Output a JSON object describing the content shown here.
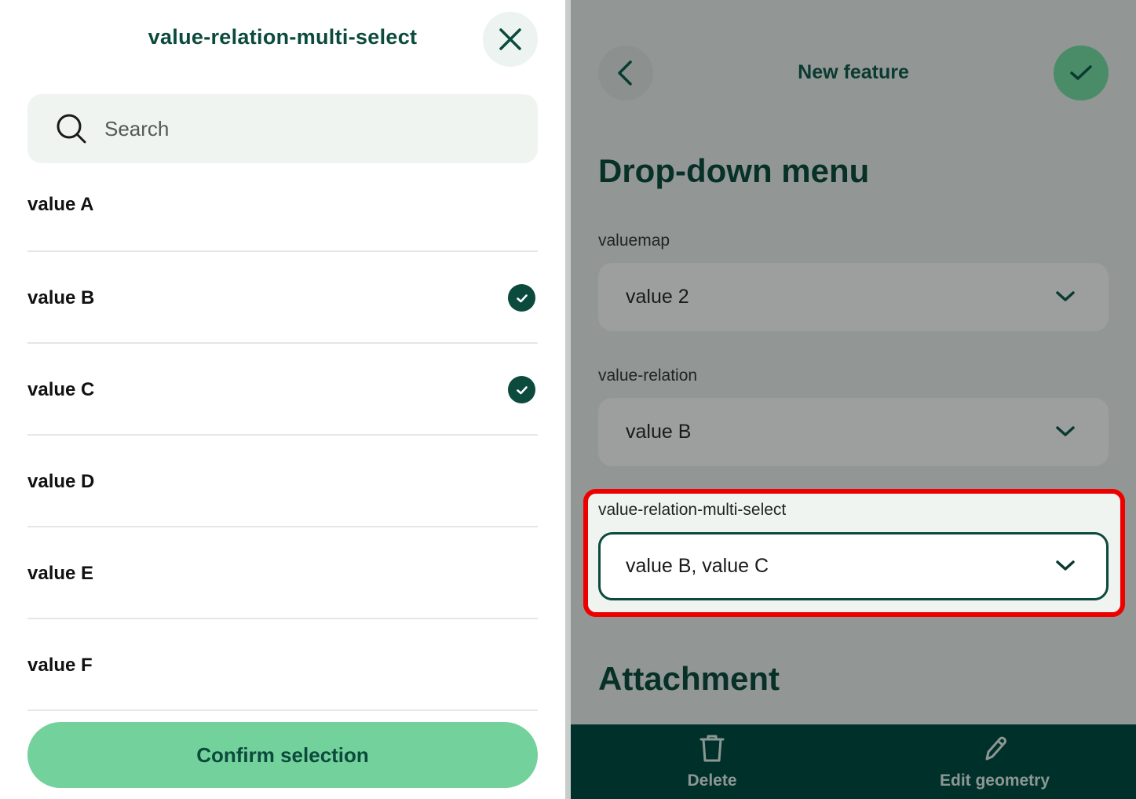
{
  "dialog": {
    "title": "value-relation-multi-select",
    "close_icon": "close-icon",
    "search": {
      "placeholder": "Search",
      "value": ""
    },
    "items": [
      {
        "label": "value A",
        "checked": false
      },
      {
        "label": "value B",
        "checked": true
      },
      {
        "label": "value C",
        "checked": true
      },
      {
        "label": "value D",
        "checked": false
      },
      {
        "label": "value E",
        "checked": false
      },
      {
        "label": "value F",
        "checked": false
      }
    ],
    "confirm_label": "Confirm selection"
  },
  "form": {
    "title": "New feature",
    "section_dropdown": "Drop-down menu",
    "fields": [
      {
        "label": "valuemap",
        "value": "value 2"
      },
      {
        "label": "value-relation",
        "value": "value B"
      },
      {
        "label": "value-relation-multi-select",
        "value": "value B, value C"
      }
    ],
    "section_attachment": "Attachment",
    "bottom": {
      "delete_label": "Delete",
      "edit_geometry_label": "Edit geometry"
    }
  },
  "colors": {
    "brand_dark": "#0b4a3c",
    "accent_green": "#73d19c",
    "highlight_red": "#ee0000",
    "bottom_bar": "#00302a"
  }
}
